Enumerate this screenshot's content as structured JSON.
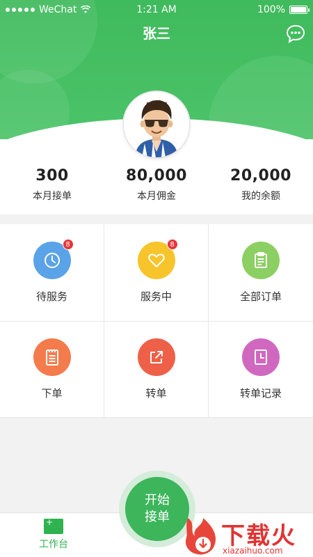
{
  "status_bar": {
    "carrier": "WeChat",
    "time": "1:21 AM",
    "battery": "100%"
  },
  "header": {
    "title": "张三"
  },
  "stats": [
    {
      "value": "300",
      "label": "本月接单"
    },
    {
      "value": "80,000",
      "label": "本月佣金"
    },
    {
      "value": "20,000",
      "label": "我的余额"
    }
  ],
  "menu": [
    {
      "label": "待服务",
      "badge": "8",
      "icon": "clock-icon",
      "color": "#5ba3e8"
    },
    {
      "label": "服务中",
      "badge": "8",
      "icon": "heart-icon",
      "color": "#f7c52b"
    },
    {
      "label": "全部订单",
      "badge": "",
      "icon": "clipboard-icon",
      "color": "#8ccf62"
    },
    {
      "label": "下单",
      "badge": "",
      "icon": "notepad-icon",
      "color": "#f47b4c"
    },
    {
      "label": "转单",
      "badge": "",
      "icon": "share-icon",
      "color": "#ee6047"
    },
    {
      "label": "转单记录",
      "badge": "",
      "icon": "record-icon",
      "color": "#d168bf"
    }
  ],
  "tabbar": {
    "workbench_label": "工作台"
  },
  "start_button": {
    "line1": "开始",
    "line2": "接单"
  },
  "watermark": {
    "text": "下载火",
    "sub": "xiazaihuo.com"
  },
  "colors": {
    "primary": "#3cb55b",
    "badge": "#e8343a"
  }
}
